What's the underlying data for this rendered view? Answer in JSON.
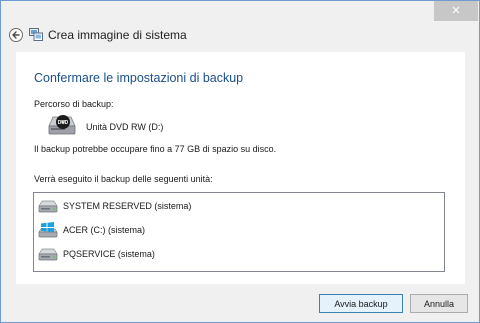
{
  "window": {
    "title": "Crea immagine di sistema",
    "back_icon": "back-arrow-icon",
    "app_icon": "system-image-icon",
    "close_icon": "close-icon",
    "accent": "#1b4f8c"
  },
  "main": {
    "heading": "Confermare le impostazioni di backup",
    "backup_path_label": "Percorso di backup:",
    "destination": {
      "name": "Unità DVD RW (D:)",
      "icon": "dvd-drive-icon"
    },
    "size_note": "Il backup potrebbe occupare fino a 77 GB di spazio su disco.",
    "drives_label": "Verrà eseguito il backup delle seguenti unità:",
    "drives": [
      {
        "name": "SYSTEM RESERVED (sistema)",
        "icon": "hard-drive-icon"
      },
      {
        "name": "ACER (C:) (sistema)",
        "icon": "windows-drive-icon"
      },
      {
        "name": "PQSERVICE (sistema)",
        "icon": "hard-drive-icon"
      }
    ]
  },
  "footer": {
    "start_label": "Avvia backup",
    "cancel_label": "Annulla"
  }
}
